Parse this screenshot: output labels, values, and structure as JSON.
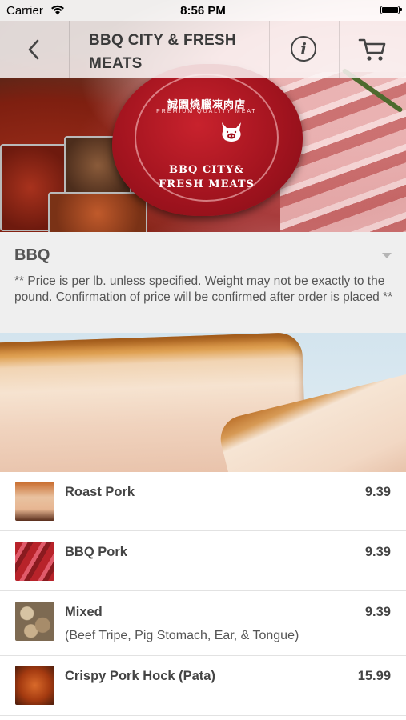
{
  "status_bar": {
    "carrier": "Carrier",
    "time": "8:56 PM"
  },
  "nav": {
    "title": "BBQ CITY & FRESH MEATS",
    "back_icon": "chevron-left-icon",
    "info_icon": "info-icon",
    "cart_icon": "cart-icon"
  },
  "seal": {
    "chinese_name": "誠園燒臘凍肉店",
    "tagline": "PREMIUM QUALITY MEAT",
    "name_line1": "BBQ CITY&",
    "name_line2": "FRESH MEATS"
  },
  "category": {
    "title": "BBQ",
    "note": "** Price is per lb. unless specified. Weight may not be exactly to the pound. Confirmation of price will be confirmed after order is placed **"
  },
  "menu": {
    "items": [
      {
        "name": "Roast Pork",
        "price": "9.39",
        "description": ""
      },
      {
        "name": "BBQ Pork",
        "price": "9.39",
        "description": ""
      },
      {
        "name": "Mixed",
        "price": "9.39",
        "description": "(Beef Tripe, Pig Stomach, Ear, & Tongue)"
      },
      {
        "name": "Crispy Pork Hock (Pata)",
        "price": "15.99",
        "description": ""
      }
    ]
  }
}
